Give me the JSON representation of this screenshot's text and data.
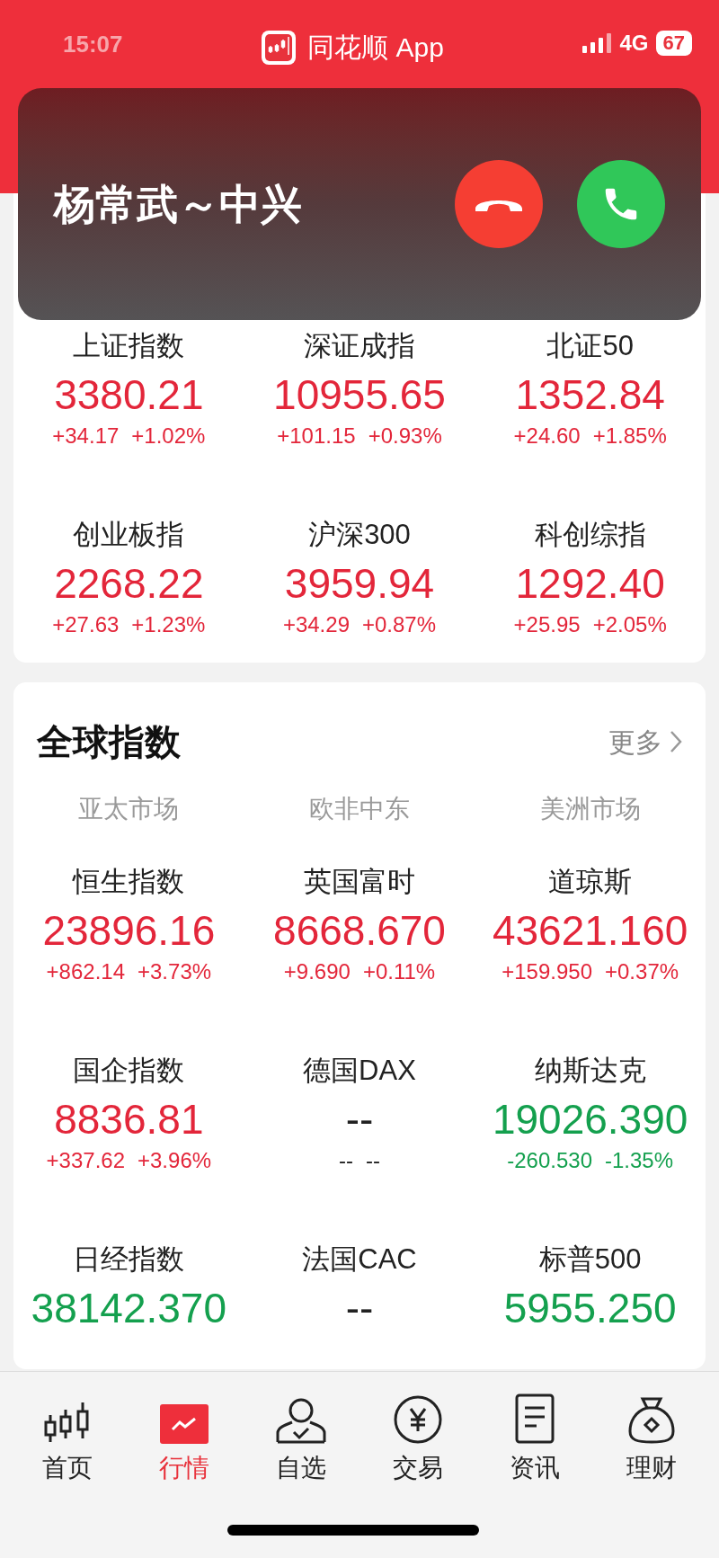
{
  "status_bar": {
    "time": "15:07",
    "app": "同花顺 App",
    "network": "4G",
    "battery": "67"
  },
  "call_banner": {
    "caller": "杨常武～中兴"
  },
  "domestic": [
    {
      "name": "上证指数",
      "value": "3380.21",
      "change": "+34.17",
      "pct": "+1.02%",
      "color": "#e3263a"
    },
    {
      "name": "深证成指",
      "value": "10955.65",
      "change": "+101.15",
      "pct": "+0.93%",
      "color": "#e3263a"
    },
    {
      "name": "北证50",
      "value": "1352.84",
      "change": "+24.60",
      "pct": "+1.85%",
      "color": "#e3263a"
    },
    {
      "name": "创业板指",
      "value": "2268.22",
      "change": "+27.63",
      "pct": "+1.23%",
      "color": "#e3263a"
    },
    {
      "name": "沪深300",
      "value": "3959.94",
      "change": "+34.29",
      "pct": "+0.87%",
      "color": "#e3263a"
    },
    {
      "name": "科创综指",
      "value": "1292.40",
      "change": "+25.95",
      "pct": "+2.05%",
      "color": "#e3263a"
    }
  ],
  "global": {
    "title": "全球指数",
    "more": "更多",
    "regions": [
      "亚太市场",
      "欧非中东",
      "美洲市场"
    ],
    "items": [
      {
        "name": "恒生指数",
        "value": "23896.16",
        "change": "+862.14",
        "pct": "+3.73%",
        "color": "#e3263a"
      },
      {
        "name": "英国富时",
        "value": "8668.670",
        "change": "+9.690",
        "pct": "+0.11%",
        "color": "#e3263a"
      },
      {
        "name": "道琼斯",
        "value": "43621.160",
        "change": "+159.950",
        "pct": "+0.37%",
        "color": "#e3263a"
      },
      {
        "name": "国企指数",
        "value": "8836.81",
        "change": "+337.62",
        "pct": "+3.96%",
        "color": "#e3263a"
      },
      {
        "name": "德国DAX",
        "value": "--",
        "change": "--",
        "pct": "--",
        "color": "#222222"
      },
      {
        "name": "纳斯达克",
        "value": "19026.390",
        "change": "-260.530",
        "pct": "-1.35%",
        "color": "#14a04e"
      },
      {
        "name": "日经指数",
        "value": "38142.370",
        "color": "#14a04e"
      },
      {
        "name": "法国CAC",
        "value": "--",
        "color": "#222222"
      },
      {
        "name": "标普500",
        "value": "5955.250",
        "color": "#14a04e"
      }
    ]
  },
  "tabbar": [
    {
      "label": "首页",
      "selected": false,
      "kind": "candles"
    },
    {
      "label": "行情",
      "selected": true,
      "kind": "chart"
    },
    {
      "label": "自选",
      "selected": false,
      "kind": "person"
    },
    {
      "label": "交易",
      "selected": false,
      "kind": "yen"
    },
    {
      "label": "资讯",
      "selected": false,
      "kind": "doc"
    },
    {
      "label": "理财",
      "selected": false,
      "kind": "bag"
    }
  ]
}
